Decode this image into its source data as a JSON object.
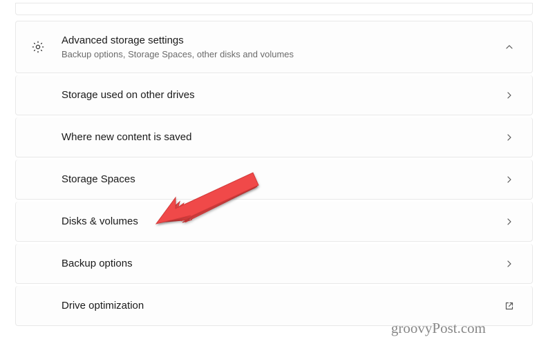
{
  "header": {
    "title": "Advanced storage settings",
    "subtitle": "Backup options, Storage Spaces, other disks and volumes"
  },
  "items": [
    {
      "label": "Storage used on other drives",
      "action": "chevron"
    },
    {
      "label": "Where new content is saved",
      "action": "chevron"
    },
    {
      "label": "Storage Spaces",
      "action": "chevron"
    },
    {
      "label": "Disks & volumes",
      "action": "chevron"
    },
    {
      "label": "Backup options",
      "action": "chevron"
    },
    {
      "label": "Drive optimization",
      "action": "external"
    }
  ],
  "watermark": "groovyPost.com",
  "annotation": {
    "arrow_target": "Disks & volumes",
    "arrow_color": "#f04a4a"
  }
}
